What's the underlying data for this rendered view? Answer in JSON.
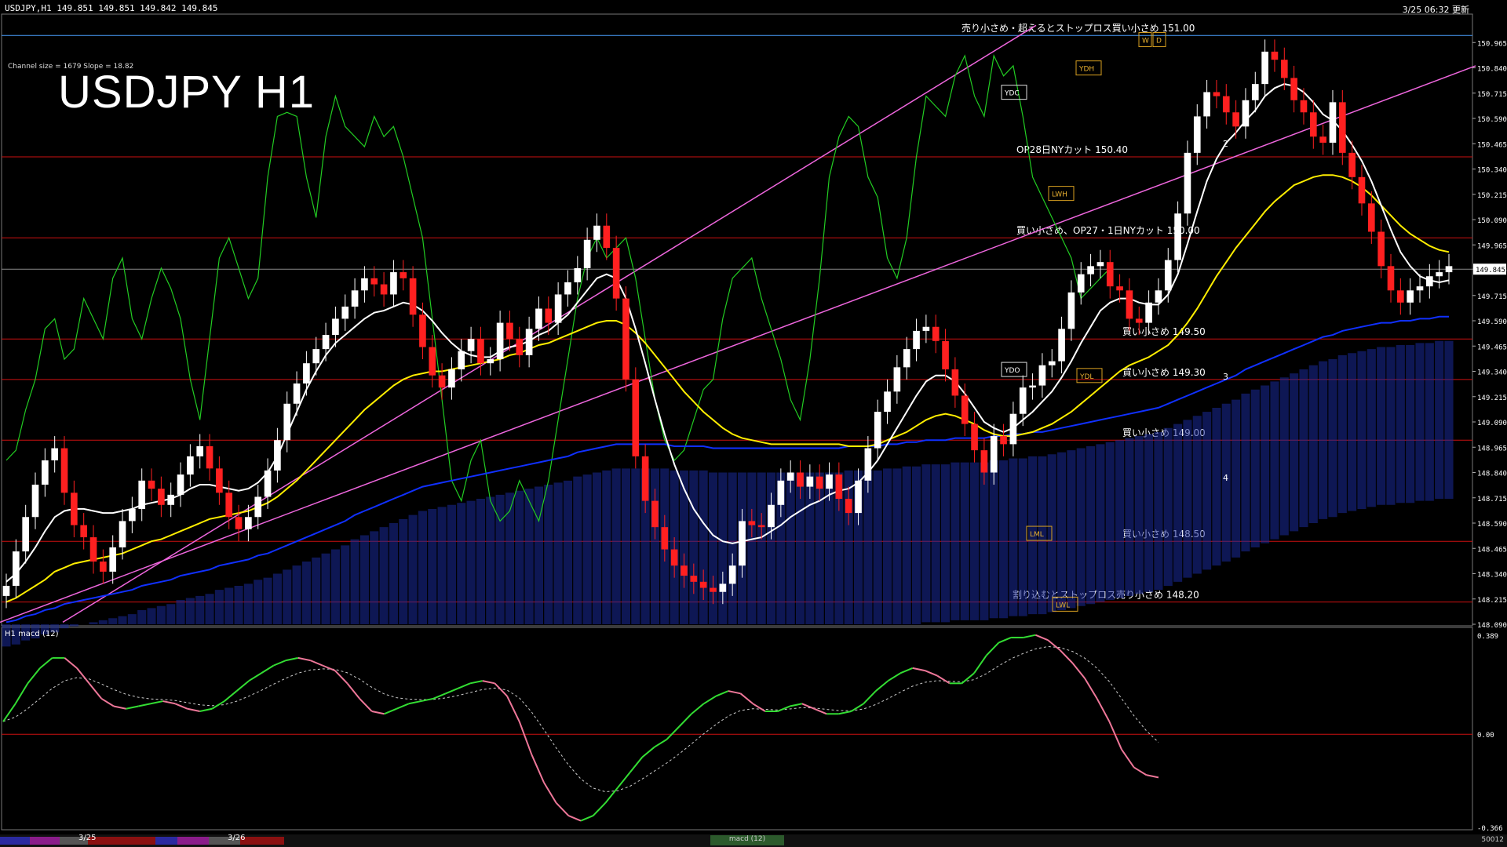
{
  "header": {
    "symbol_info": "USDJPY,H1 149.851 149.851 149.842 149.845",
    "timestamp": "3/25 06:32 更新",
    "title": "USDJPY H1",
    "channel_info": "Channel size = 1679 Slope = 18.82"
  },
  "colors": {
    "background": "#000000",
    "bull": "#ffffff",
    "bear": "#ff2020",
    "level_line": "#cc1010",
    "channel": "#ee66dd",
    "ma_white": "#ffffff",
    "ma_yellow": "#ffee00",
    "ma_blue": "#1030ff",
    "chikou": "#22cc22",
    "cloud_bull": "#1a2a9a",
    "cloud_bear": "#d08060"
  },
  "chart_data": [
    {
      "type": "line",
      "title": "USDJPY H1",
      "ylim": [
        148.09,
        151.09
      ],
      "price_ticks": [
        150.965,
        150.84,
        150.715,
        150.59,
        150.465,
        150.34,
        150.215,
        150.09,
        149.965,
        149.845,
        149.715,
        149.59,
        149.465,
        149.34,
        149.215,
        149.09,
        148.965,
        148.84,
        148.715,
        148.59,
        148.465,
        148.34,
        148.215,
        148.09
      ],
      "current_price": 149.845,
      "x_labels": [
        "3/25",
        "3/26"
      ],
      "price_levels": [
        {
          "price": 151.0,
          "label": "売り小さめ・超えるとストップロス買い小さめ 151.00"
        },
        {
          "price": 150.4,
          "label": "OP28日NYカット 150.40"
        },
        {
          "price": 150.0,
          "label": "買い小さめ、OP27・1日NYカット 150.00"
        },
        {
          "price": 149.5,
          "label": "買い小さめ 149.50"
        },
        {
          "price": 149.3,
          "label": "買い小さめ 149.30"
        },
        {
          "price": 149.0,
          "label": "買い小さめ 149.00"
        },
        {
          "price": 148.5,
          "label": "買い小さめ 148.50"
        },
        {
          "price": 148.2,
          "label": "割り込むとストップロス売り小さめ 148.20"
        }
      ],
      "box_labels": [
        "YDC",
        "YDH",
        "LWH",
        "YDO",
        "YDL",
        "LML",
        "LWL",
        "W",
        "D"
      ],
      "projection_labels": [
        "2",
        "3",
        "4"
      ],
      "series_close": [
        148.28,
        148.45,
        148.62,
        148.78,
        148.9,
        148.96,
        148.74,
        148.58,
        148.52,
        148.4,
        148.35,
        148.47,
        148.6,
        148.66,
        148.8,
        148.76,
        148.68,
        148.73,
        148.83,
        148.92,
        148.97,
        148.86,
        148.74,
        148.62,
        148.56,
        148.62,
        148.72,
        148.85,
        149.0,
        149.18,
        149.28,
        149.38,
        149.45,
        149.52,
        149.6,
        149.66,
        149.74,
        149.8,
        149.77,
        149.72,
        149.83,
        149.8,
        149.62,
        149.46,
        149.32,
        149.26,
        149.35,
        149.44,
        149.5,
        149.38,
        149.4,
        149.58,
        149.5,
        149.42,
        149.55,
        149.65,
        149.58,
        149.72,
        149.78,
        149.85,
        149.99,
        150.06,
        149.95,
        149.7,
        149.3,
        148.92,
        148.7,
        148.57,
        148.46,
        148.38,
        148.33,
        148.3,
        148.27,
        148.25,
        148.29,
        148.38,
        148.6,
        148.58,
        148.57,
        148.68,
        148.8,
        148.84,
        148.77,
        148.82,
        148.76,
        148.83,
        148.71,
        148.64,
        148.8,
        148.96,
        149.14,
        149.24,
        149.36,
        149.45,
        149.54,
        149.56,
        149.49,
        149.35,
        149.22,
        149.08,
        148.95,
        148.84,
        149.02,
        148.98,
        149.13,
        149.26,
        149.27,
        149.37,
        149.39,
        149.55,
        149.73,
        149.82,
        149.86,
        149.88,
        149.76,
        149.74,
        149.6,
        149.58,
        149.68,
        149.74,
        149.89,
        150.12,
        150.42,
        150.6,
        150.72,
        150.7,
        150.62,
        150.55,
        150.68,
        150.76,
        150.92,
        150.88,
        150.79,
        150.68,
        150.62,
        150.5,
        150.47,
        150.67,
        150.42,
        150.3,
        150.17,
        150.03,
        149.86,
        149.74,
        149.68,
        149.74,
        149.76,
        149.81,
        149.83,
        149.86
      ],
      "ma_fast": [
        148.3,
        148.34,
        148.4,
        148.47,
        148.55,
        148.62,
        148.65,
        148.66,
        148.66,
        148.65,
        148.64,
        148.64,
        148.65,
        148.66,
        148.68,
        148.69,
        148.7,
        148.71,
        148.73,
        148.76,
        148.78,
        148.78,
        148.77,
        148.76,
        148.75,
        148.76,
        148.79,
        148.84,
        148.92,
        149.03,
        149.14,
        149.25,
        149.34,
        149.42,
        149.48,
        149.52,
        149.56,
        149.6,
        149.63,
        149.64,
        149.66,
        149.68,
        149.67,
        149.64,
        149.59,
        149.53,
        149.48,
        149.44,
        149.42,
        149.41,
        149.41,
        149.44,
        149.46,
        149.47,
        149.49,
        149.52,
        149.54,
        149.58,
        149.62,
        149.68,
        149.74,
        149.8,
        149.82,
        149.8,
        149.7,
        149.55,
        149.38,
        149.2,
        149.03,
        148.88,
        148.76,
        148.66,
        148.59,
        148.53,
        148.5,
        148.49,
        148.5,
        148.51,
        148.52,
        148.55,
        148.58,
        148.62,
        148.65,
        148.68,
        148.7,
        148.73,
        148.75,
        148.76,
        148.79,
        148.84,
        148.9,
        148.98,
        149.06,
        149.14,
        149.22,
        149.29,
        149.32,
        149.32,
        149.29,
        149.23,
        149.16,
        149.09,
        149.06,
        149.04,
        149.06,
        149.1,
        149.14,
        149.19,
        149.24,
        149.31,
        149.39,
        149.48,
        149.56,
        149.64,
        149.68,
        149.7,
        149.7,
        149.68,
        149.67,
        149.67,
        149.72,
        149.82,
        149.97,
        150.13,
        150.28,
        150.39,
        150.47,
        150.52,
        150.58,
        150.63,
        150.7,
        150.74,
        150.76,
        150.75,
        150.72,
        150.67,
        150.61,
        150.58,
        150.53,
        150.46,
        150.38,
        150.28,
        150.16,
        150.04,
        149.93,
        149.86,
        149.81,
        149.79,
        149.78,
        149.79
      ],
      "ma_mid": [
        148.2,
        148.22,
        148.25,
        148.28,
        148.31,
        148.35,
        148.37,
        148.39,
        148.4,
        148.41,
        148.42,
        148.43,
        148.44,
        148.46,
        148.48,
        148.5,
        148.51,
        148.53,
        148.55,
        148.57,
        148.59,
        148.61,
        148.62,
        148.63,
        148.64,
        148.65,
        148.67,
        148.69,
        148.72,
        148.76,
        148.8,
        148.85,
        148.9,
        148.95,
        149.0,
        149.05,
        149.1,
        149.15,
        149.19,
        149.23,
        149.27,
        149.3,
        149.32,
        149.33,
        149.34,
        149.34,
        149.35,
        149.36,
        149.37,
        149.38,
        149.39,
        149.4,
        149.42,
        149.43,
        149.45,
        149.47,
        149.48,
        149.5,
        149.52,
        149.54,
        149.56,
        149.58,
        149.59,
        149.59,
        149.57,
        149.53,
        149.48,
        149.42,
        149.36,
        149.3,
        149.24,
        149.19,
        149.14,
        149.1,
        149.06,
        149.03,
        149.01,
        149.0,
        148.99,
        148.98,
        148.98,
        148.98,
        148.98,
        148.98,
        148.98,
        148.98,
        148.98,
        148.97,
        148.97,
        148.97,
        148.98,
        149.0,
        149.02,
        149.04,
        149.07,
        149.1,
        149.12,
        149.13,
        149.12,
        149.1,
        149.08,
        149.05,
        149.03,
        149.02,
        149.02,
        149.03,
        149.04,
        149.06,
        149.08,
        149.11,
        149.14,
        149.18,
        149.22,
        149.26,
        149.3,
        149.34,
        149.37,
        149.39,
        149.41,
        149.44,
        149.47,
        149.52,
        149.58,
        149.65,
        149.73,
        149.81,
        149.88,
        149.95,
        150.01,
        150.07,
        150.13,
        150.18,
        150.22,
        150.26,
        150.28,
        150.3,
        150.31,
        150.31,
        150.3,
        150.28,
        150.25,
        150.21,
        150.16,
        150.11,
        150.06,
        150.02,
        149.99,
        149.96,
        149.94,
        149.93
      ],
      "ma_slow": [
        148.1,
        148.11,
        148.13,
        148.14,
        148.16,
        148.17,
        148.19,
        148.2,
        148.21,
        148.22,
        148.23,
        148.24,
        148.25,
        148.26,
        148.28,
        148.29,
        148.3,
        148.31,
        148.33,
        148.34,
        148.35,
        148.36,
        148.38,
        148.39,
        148.4,
        148.41,
        148.43,
        148.44,
        148.46,
        148.48,
        148.5,
        148.52,
        148.54,
        148.56,
        148.58,
        148.6,
        148.63,
        148.65,
        148.67,
        148.69,
        148.71,
        148.73,
        148.75,
        148.77,
        148.78,
        148.79,
        148.8,
        148.81,
        148.82,
        148.83,
        148.84,
        148.85,
        148.86,
        148.87,
        148.88,
        148.89,
        148.9,
        148.91,
        148.92,
        148.94,
        148.95,
        148.96,
        148.97,
        148.98,
        148.98,
        148.98,
        148.98,
        148.98,
        148.98,
        148.97,
        148.97,
        148.97,
        148.97,
        148.96,
        148.96,
        148.96,
        148.96,
        148.96,
        148.96,
        148.96,
        148.96,
        148.96,
        148.96,
        148.96,
        148.96,
        148.96,
        148.96,
        148.97,
        148.97,
        148.97,
        148.97,
        148.98,
        148.98,
        148.99,
        148.99,
        149.0,
        149.0,
        149.0,
        149.01,
        149.01,
        149.01,
        149.01,
        149.02,
        149.02,
        149.03,
        149.03,
        149.04,
        149.04,
        149.05,
        149.06,
        149.07,
        149.08,
        149.09,
        149.1,
        149.11,
        149.12,
        149.13,
        149.14,
        149.15,
        149.16,
        149.18,
        149.2,
        149.22,
        149.24,
        149.26,
        149.28,
        149.3,
        149.32,
        149.35,
        149.37,
        149.39,
        149.41,
        149.43,
        149.45,
        149.47,
        149.49,
        149.51,
        149.52,
        149.54,
        149.55,
        149.56,
        149.57,
        149.58,
        149.58,
        149.59,
        149.59,
        149.6,
        149.6,
        149.61,
        149.61
      ],
      "chikou": [
        148.9,
        148.95,
        149.15,
        149.3,
        149.55,
        149.6,
        149.4,
        149.45,
        149.7,
        149.6,
        149.5,
        149.8,
        149.9,
        149.6,
        149.5,
        149.7,
        149.85,
        149.75,
        149.6,
        149.3,
        149.1,
        149.5,
        149.9,
        150.0,
        149.85,
        149.7,
        149.8,
        150.3,
        150.6,
        150.62,
        150.6,
        150.3,
        150.1,
        150.5,
        150.7,
        150.55,
        150.5,
        150.45,
        150.6,
        150.5,
        150.55,
        150.4,
        150.2,
        150.0,
        149.6,
        149.2,
        148.8,
        148.7,
        148.9,
        149.0,
        148.7,
        148.6,
        148.65,
        148.8,
        148.7,
        148.6,
        148.8,
        149.1,
        149.4,
        149.7,
        149.9,
        150.0,
        149.9,
        149.95,
        150.0,
        149.8,
        149.5,
        149.2,
        149.0,
        148.9,
        148.95,
        149.1,
        149.25,
        149.3,
        149.6,
        149.8,
        149.85,
        149.9,
        149.7,
        149.55,
        149.4,
        149.2,
        149.1,
        149.4,
        149.8,
        150.3,
        150.5,
        150.6,
        150.55,
        150.3,
        150.2,
        149.9,
        149.8,
        150.0,
        150.4,
        150.7,
        150.65,
        150.6,
        150.8,
        150.9,
        150.7,
        150.6,
        150.9,
        150.8,
        150.85,
        150.6,
        150.3,
        150.2,
        150.1,
        150.0,
        149.9,
        149.7,
        149.75,
        149.8,
        149.85
      ]
    },
    {
      "type": "line",
      "title": "macd (12)",
      "ylim": [
        -0.366,
        0.389
      ],
      "y_ticks": [
        0.389,
        0.0,
        -0.366
      ],
      "macd": [
        0.05,
        0.12,
        0.2,
        0.26,
        0.3,
        0.3,
        0.26,
        0.2,
        0.14,
        0.11,
        0.1,
        0.11,
        0.12,
        0.13,
        0.12,
        0.1,
        0.09,
        0.1,
        0.13,
        0.17,
        0.21,
        0.24,
        0.27,
        0.29,
        0.3,
        0.29,
        0.27,
        0.25,
        0.2,
        0.14,
        0.09,
        0.08,
        0.1,
        0.12,
        0.13,
        0.14,
        0.16,
        0.18,
        0.2,
        0.21,
        0.2,
        0.15,
        0.05,
        -0.08,
        -0.19,
        -0.27,
        -0.32,
        -0.34,
        -0.32,
        -0.27,
        -0.21,
        -0.15,
        -0.09,
        -0.05,
        -0.02,
        0.03,
        0.08,
        0.12,
        0.15,
        0.17,
        0.16,
        0.12,
        0.09,
        0.09,
        0.11,
        0.12,
        0.1,
        0.08,
        0.08,
        0.09,
        0.12,
        0.17,
        0.21,
        0.24,
        0.26,
        0.25,
        0.23,
        0.2,
        0.2,
        0.24,
        0.31,
        0.36,
        0.38,
        0.38,
        0.39,
        0.37,
        0.33,
        0.28,
        0.22,
        0.14,
        0.05,
        -0.06,
        -0.13,
        -0.16,
        -0.17
      ]
    }
  ],
  "footer": {
    "date_labels": [
      "3/25",
      "3/26"
    ],
    "tab_label": "macd (12)",
    "corner": "50012"
  }
}
